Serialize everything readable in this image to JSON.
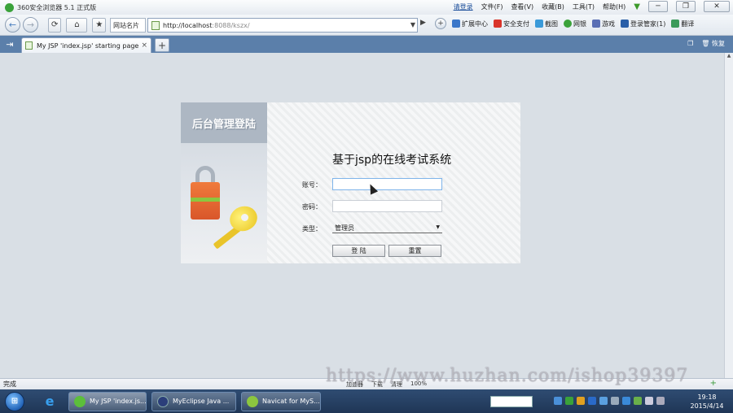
{
  "window": {
    "title": "360安全浏览器 5.1 正式版",
    "login_link": "请登录",
    "menu": [
      "文件(F)",
      "查看(V)",
      "收藏(B)",
      "工具(T)",
      "帮助(H)"
    ],
    "minimize": "─",
    "restore": "❐",
    "close": "✕"
  },
  "navbar": {
    "back": "←",
    "forward": "→",
    "refresh": "⟳",
    "home": "⌂",
    "favorite": "★",
    "site_name": "网站名片",
    "url_host": "http://localhost",
    "url_rest": ":8088/kszx/",
    "go": "▶",
    "tools": [
      "扩展中心",
      "安全支付",
      "截图",
      "网银",
      "游戏",
      "登录管家(1)",
      "翻译"
    ]
  },
  "tabs": {
    "active_label": "My JSP 'index.jsp' starting page",
    "close": "×",
    "new_tab": "+",
    "restore_label": "恢复"
  },
  "login": {
    "panel_title": "后台管理登陆",
    "system_title": "基于jsp的在线考试系统",
    "account_label": "账号：",
    "password_label": "密码：",
    "type_label": "类型：",
    "type_value": "管理员",
    "login_button": "登 陆",
    "reset_button": "重置"
  },
  "statusbar": {
    "text": "完成",
    "items": [
      "加速器",
      "下载",
      "清理",
      "100%"
    ]
  },
  "taskbar": {
    "start": "⊞",
    "tasks": [
      "My JSP 'index.js...",
      "MyEclipse Java ...",
      "Navicat for MyS..."
    ],
    "time": "19:18",
    "date": "2015/4/14"
  },
  "watermark": "https://www.huzhan.com/ishop39397"
}
